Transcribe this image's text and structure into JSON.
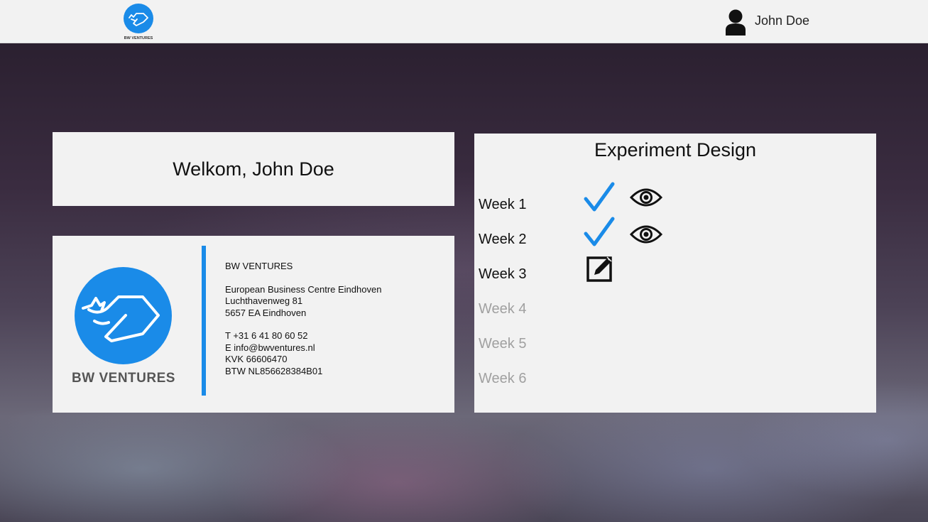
{
  "header": {
    "logo_icon": "bw-ventures-logo-icon",
    "logo_text": "BW VENTURES",
    "user_icon": "user-icon",
    "user_name": "John Doe"
  },
  "welcome": {
    "text": "Welkom, John Doe"
  },
  "business_card": {
    "brand": "BW VENTURES",
    "accent_color": "#1a8be8",
    "lines": {
      "company": "BW VENTURES",
      "address1": "European Business Centre Eindhoven",
      "address2": "Luchthavenweg 81",
      "address3": "5657 EA Eindhoven",
      "phone": "T +31 6 41 80 60 52",
      "email": "E info@bwventures.nl",
      "kvk": "KVK 66606470",
      "btw": "BTW NL856628384B01"
    }
  },
  "experiment": {
    "title": "Experiment Design",
    "weeks": [
      {
        "label": "Week 1",
        "status": "completed",
        "icons": [
          "check-icon",
          "eye-icon"
        ]
      },
      {
        "label": "Week 2",
        "status": "completed",
        "icons": [
          "check-icon",
          "eye-icon"
        ]
      },
      {
        "label": "Week 3",
        "status": "current",
        "icons": [
          "edit-icon"
        ]
      },
      {
        "label": "Week 4",
        "status": "locked",
        "icons": []
      },
      {
        "label": "Week 5",
        "status": "locked",
        "icons": []
      },
      {
        "label": "Week 6",
        "status": "locked",
        "icons": []
      }
    ],
    "colors": {
      "check": "#1a8be8",
      "active_text": "#111111",
      "locked_text": "#a0a0a0"
    }
  }
}
